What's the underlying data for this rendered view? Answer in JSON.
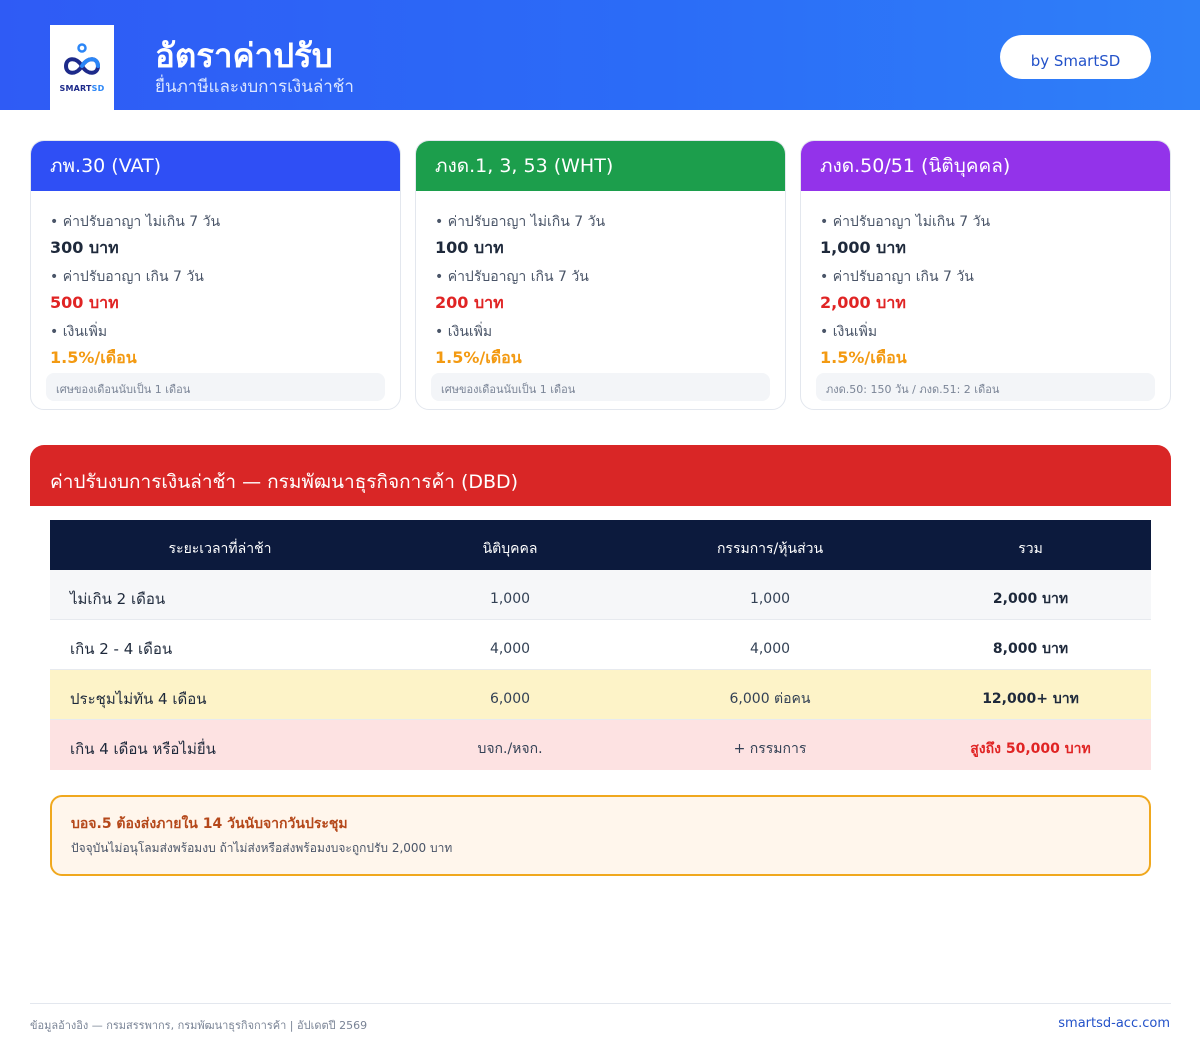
{
  "header": {
    "logo_text_a": "SMART",
    "logo_text_b": "SD",
    "title": "อัตราค่าปรับ",
    "subtitle": "ยื่นภาษีและงบการเงินล่าช้า",
    "by_label": "by SmartSD",
    "gradient_color": "#2f5bf5"
  },
  "cards": [
    {
      "title": "ภพ.30 (VAT)",
      "color": "#2f4ff5",
      "items": [
        {
          "label": "• ค่าปรับอาญา ไม่เกิน 7 วัน",
          "value": "300 บาท"
        },
        {
          "label": "• ค่าปรับอาญา เกิน 7 วัน",
          "value": "500 บาท"
        },
        {
          "label": "• เงินเพิ่ม",
          "value": "1.5%/เดือน"
        }
      ],
      "note": "เศษของเดือนนับเป็น 1 เดือน"
    },
    {
      "title": "ภงด.1, 3, 53 (WHT)",
      "color": "#1c9e4c",
      "items": [
        {
          "label": "• ค่าปรับอาญา ไม่เกิน 7 วัน",
          "value": "100 บาท"
        },
        {
          "label": "• ค่าปรับอาญา เกิน 7 วัน",
          "value": "200 บาท"
        },
        {
          "label": "• เงินเพิ่ม",
          "value": "1.5%/เดือน"
        }
      ],
      "note": "เศษของเดือนนับเป็น 1 เดือน"
    },
    {
      "title": "ภงด.50/51 (นิติบุคคล)",
      "color": "#9333ea",
      "items": [
        {
          "label": "• ค่าปรับอาญา ไม่เกิน 7 วัน",
          "value": "1,000 บาท"
        },
        {
          "label": "• ค่าปรับอาญา เกิน 7 วัน",
          "value": "2,000 บาท"
        },
        {
          "label": "• เงินเพิ่ม",
          "value": "1.5%/เดือน"
        }
      ],
      "note": "ภงด.50: 150 วัน / ภงด.51: 2 เดือน"
    }
  ],
  "dbd": {
    "title": "ค่าปรับงบการเงินล่าช้า — กรมพัฒนาธุรกิจการค้า (DBD)",
    "color": "#d92626",
    "columns": [
      "ระยะเวลาที่ล่าช้า",
      "นิติบุคคล",
      "กรรมการ/หุ้นส่วน",
      "รวม"
    ],
    "rows": [
      [
        "ไม่เกิน 2 เดือน",
        "1,000",
        "1,000",
        "2,000 บาท"
      ],
      [
        "เกิน 2 - 4 เดือน",
        "4,000",
        "4,000",
        "8,000 บาท"
      ],
      [
        "ประชุมไม่ทัน 4 เดือน",
        "6,000",
        "6,000 ต่อคน",
        "12,000+ บาท"
      ],
      [
        "เกิน 4 เดือน หรือไม่ยื่น",
        "บจก./หจก.",
        "+ กรรมการ",
        "สูงถึง 50,000 บาท"
      ]
    ]
  },
  "note": {
    "title": "บอจ.5 ต้องส่งภายใน 14 วันนับจากวันประชุม",
    "text": "ปัจจุบันไม่อนุโลมส่งพร้อมงบ ถ้าไม่ส่งหรือส่งพร้อมงบจะถูกปรับ 2,000 บาท"
  },
  "footer": {
    "source": "ข้อมูลอ้างอิง — กรมสรรพากร, กรมพัฒนาธุรกิจการค้า | อัปเดตปี 2569",
    "site": "smartsd-acc.com"
  }
}
